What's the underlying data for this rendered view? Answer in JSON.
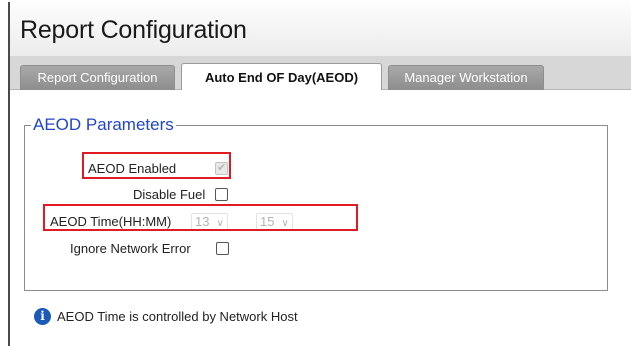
{
  "window": {
    "title": "Report Configuration"
  },
  "tabs": [
    {
      "label": "Report Configuration",
      "active": false
    },
    {
      "label": "Auto End OF Day(AEOD)",
      "active": true
    },
    {
      "label": "Manager Workstation",
      "active": false
    }
  ],
  "aeod": {
    "legend": "AEOD Parameters",
    "enabled_label": "AEOD Enabled",
    "enabled_checked": true,
    "enabled_disabled": true,
    "disable_fuel_label": "Disable Fuel",
    "disable_fuel_checked": false,
    "time_label": "AEOD Time(HH:MM)",
    "hour_value": "13",
    "minute_value": "15",
    "ignore_network_label": "Ignore Network Error",
    "ignore_network_checked": false
  },
  "info": {
    "icon": "info-icon",
    "text": "AEOD Time is controlled by Network Host"
  },
  "colors": {
    "legend_text": "#2146c8",
    "highlight_border": "#e01b24",
    "info_icon_bg": "#1b5ab8",
    "inactive_tab_bg": "#9b9b9b"
  }
}
